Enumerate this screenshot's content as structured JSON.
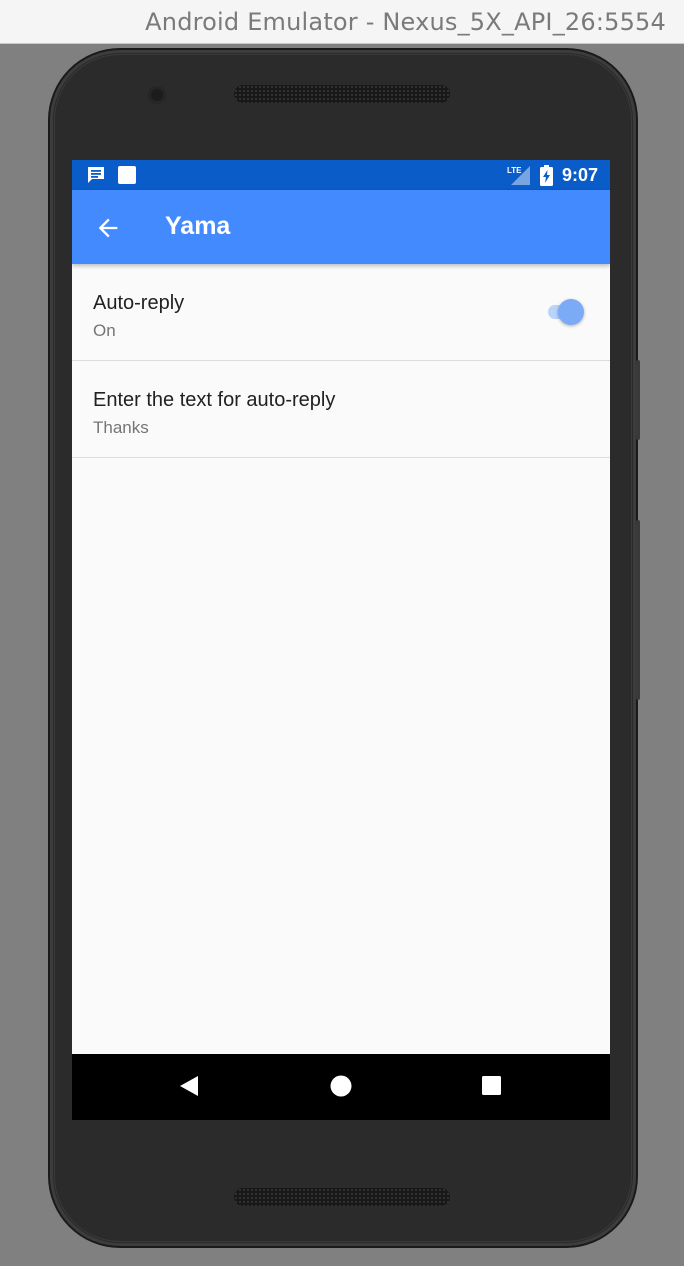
{
  "window": {
    "title": "Android Emulator - Nexus_5X_API_26:5554"
  },
  "status_bar": {
    "time": "9:07",
    "network_label": "LTE",
    "icons": [
      "message-notification-icon",
      "square-notification-icon",
      "lte-signal-icon",
      "battery-charging-icon"
    ]
  },
  "app_bar": {
    "title": "Yama",
    "back_icon": "arrow-back-icon"
  },
  "preferences": [
    {
      "title": "Auto-reply",
      "summary": "On",
      "switch_on": true
    },
    {
      "title": "Enter the text for auto-reply",
      "summary": "Thanks"
    }
  ],
  "nav_bar": {
    "icons": [
      "back-triangle-icon",
      "home-circle-icon",
      "recents-square-icon"
    ]
  },
  "colors": {
    "status_bar": "#0a5cc8",
    "app_bar": "#448aff",
    "switch_thumb": "#7baaf7",
    "switch_track": "#b9d3fb",
    "background": "#fafafa"
  }
}
